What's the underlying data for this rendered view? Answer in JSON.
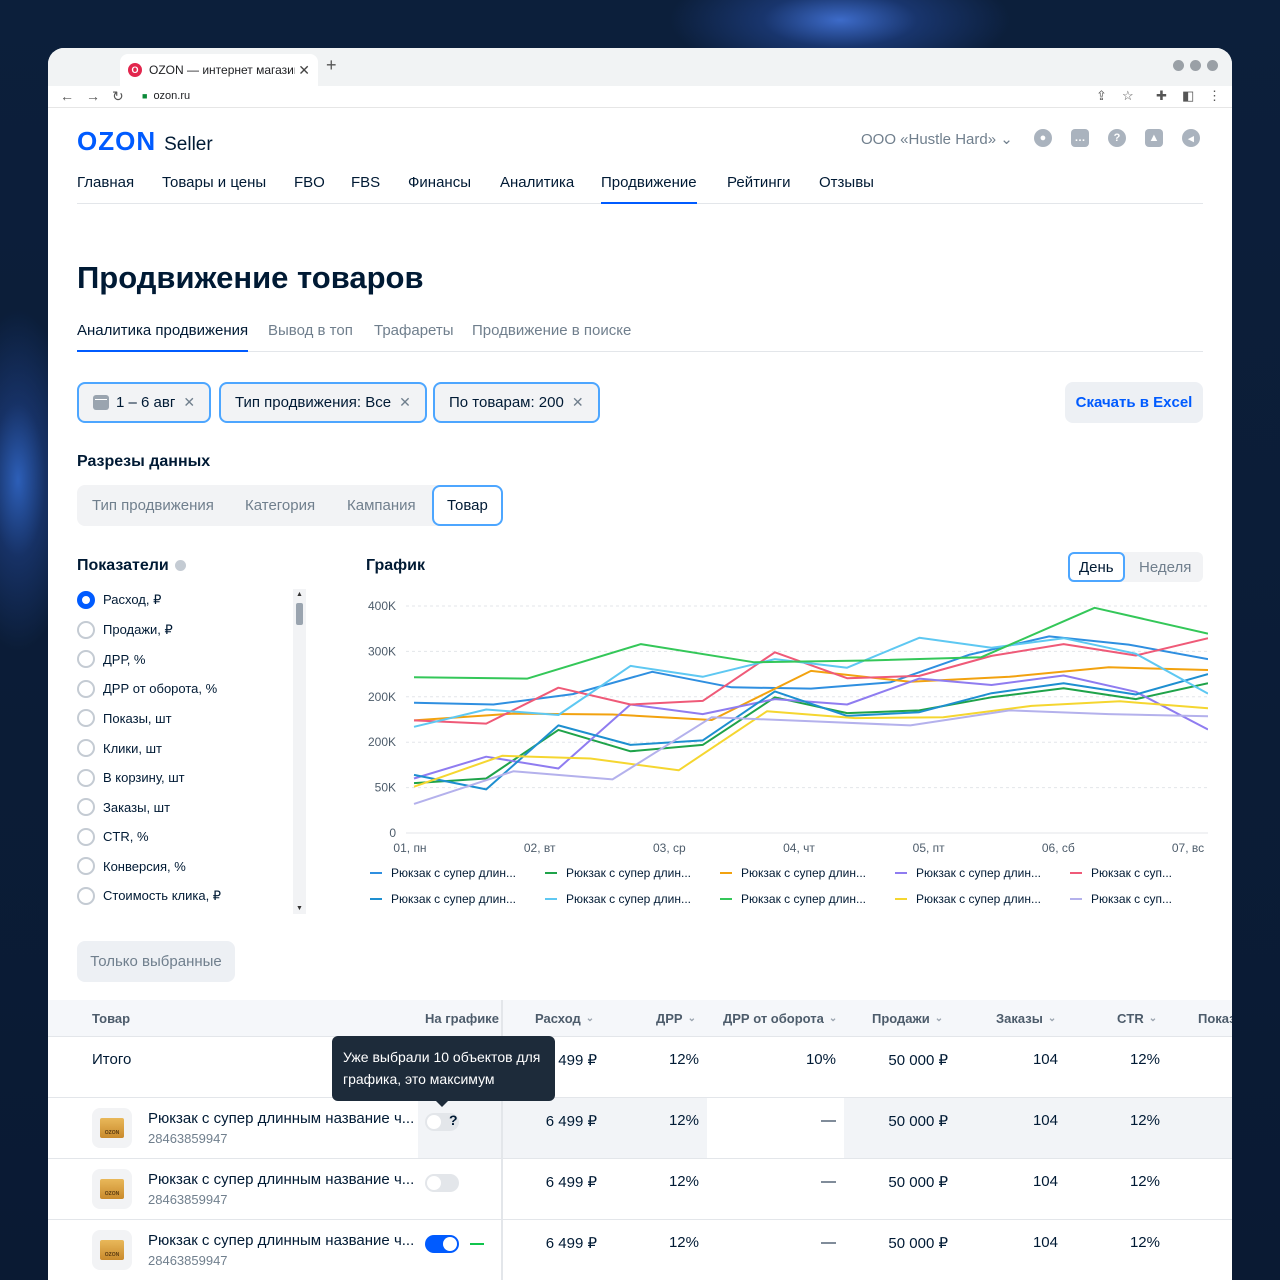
{
  "browser": {
    "tab_title": "OZON — интернет магазин",
    "tab_favicon": "ozon-favicon",
    "new_tab": "+",
    "close": "✕",
    "url": "ozon.ru"
  },
  "header": {
    "logo": "OZON",
    "logo_sub": "Seller",
    "org": "ООО «Hustle Hard» ⌄",
    "icons": [
      "user-icon",
      "chat-icon",
      "help-icon",
      "education-icon",
      "megaphone-icon"
    ]
  },
  "main_nav": [
    {
      "label": "Главная",
      "active": false
    },
    {
      "label": "Товары и цены",
      "active": false
    },
    {
      "label": "FBO",
      "active": false
    },
    {
      "label": "FBS",
      "active": false
    },
    {
      "label": "Финансы",
      "active": false
    },
    {
      "label": "Аналитика",
      "active": false
    },
    {
      "label": "Продвижение",
      "active": true
    },
    {
      "label": "Рейтинги",
      "active": false
    },
    {
      "label": "Отзывы",
      "active": false
    }
  ],
  "page_title": "Продвижение товаров",
  "sub_nav": [
    {
      "label": "Аналитика продвижения",
      "active": true
    },
    {
      "label": "Вывод в топ",
      "active": false
    },
    {
      "label": "Трафареты",
      "active": false
    },
    {
      "label": "Продвижение в поиске",
      "active": false
    }
  ],
  "filters": [
    {
      "label": "1 – 6 авг"
    },
    {
      "label": "Тип продвижения: Все"
    },
    {
      "label": "По товарам: 200"
    }
  ],
  "excel_button": "Скачать в Excel",
  "slices": {
    "title": "Разрезы данных",
    "items": [
      {
        "label": "Тип продвижения",
        "active": false
      },
      {
        "label": "Категория",
        "active": false
      },
      {
        "label": "Кампания",
        "active": false
      },
      {
        "label": "Товар",
        "active": true
      }
    ]
  },
  "metrics": {
    "title": "Показатели",
    "items": [
      {
        "label": "Расход, ₽",
        "selected": true
      },
      {
        "label": "Продажи, ₽",
        "selected": false
      },
      {
        "label": "ДРР, %",
        "selected": false
      },
      {
        "label": "ДРР от оборота, %",
        "selected": false
      },
      {
        "label": "Показы, шт",
        "selected": false
      },
      {
        "label": "Клики, шт",
        "selected": false
      },
      {
        "label": "В корзину, шт",
        "selected": false
      },
      {
        "label": "Заказы, шт",
        "selected": false
      },
      {
        "label": "CTR, %",
        "selected": false
      },
      {
        "label": "Конверсия, %",
        "selected": false
      },
      {
        "label": "Стоимость клика, ₽",
        "selected": false
      }
    ]
  },
  "chart_title": "График",
  "period": [
    {
      "label": "День",
      "active": true
    },
    {
      "label": "Неделя",
      "active": false
    }
  ],
  "chart_data": {
    "type": "line",
    "x": [
      "01, пн",
      "02, вт",
      "03, ср",
      "04, чт",
      "05, пт",
      "06, сб",
      "07, вс"
    ],
    "y_ticks": [
      0,
      50000,
      100000,
      200000,
      300000,
      400000
    ],
    "y_tick_labels": [
      "0",
      "50K",
      "200K",
      "200K",
      "300K",
      "400K"
    ],
    "ylim": [
      0,
      400000
    ],
    "grid": true,
    "legend_position": "bottom",
    "series": [
      {
        "name": "Рюкзак с супер длинным названием",
        "color": "#2f8fe0",
        "values": [
          187000,
          183000,
          206000,
          255000,
          221000,
          218000,
          232000,
          293000,
          333000,
          315000,
          283000
        ]
      },
      {
        "name": "Рюкзак с супер длинным названием",
        "color": "#1fa34a",
        "values": [
          55000,
          60000,
          127000,
          90000,
          97000,
          199000,
          164000,
          170000,
          199000,
          219000,
          195000,
          230000
        ]
      },
      {
        "name": "Рюкзак с супер длинным названием",
        "color": "#f2a20f",
        "values": [
          148000,
          163000,
          161000,
          149000,
          257000,
          233000,
          244000,
          265000,
          259000
        ]
      },
      {
        "name": "Рюкзак с супер длинным названием",
        "color": "#8f7cf0",
        "values": [
          60000,
          84000,
          71000,
          183000,
          162000,
          195000,
          183000,
          240000,
          226000,
          247000,
          211000,
          128000
        ]
      },
      {
        "name": "Рюкзак с супер длинным названием",
        "color": "#ef5a78",
        "values": [
          148000,
          141000,
          220000,
          183000,
          191000,
          298000,
          241000,
          246000,
          290000,
          316000,
          291000,
          329000
        ]
      },
      {
        "name": "Рюкзак с супер длинным названием",
        "color": "#1e8fd0",
        "values": [
          64000,
          48000,
          137000,
          97000,
          104000,
          212000,
          158000,
          166000,
          208000,
          230000,
          205000,
          250000
        ]
      },
      {
        "name": "Рюкзак с супер длинным названием",
        "color": "#5ec8f2",
        "values": [
          134000,
          172000,
          160000,
          268000,
          244000,
          283000,
          264000,
          330000,
          308000,
          329000,
          295000,
          207000
        ]
      },
      {
        "name": "Рюкзак с супер длинным названием",
        "color": "#34c759",
        "values": [
          243000,
          240000,
          316000,
          276000,
          280000,
          287000,
          396000,
          339000
        ]
      },
      {
        "name": "Рюкзак с супер длинным названием",
        "color": "#f5d630",
        "values": [
          51000,
          85000,
          82000,
          69000,
          168000,
          153000,
          155000,
          180000,
          190000,
          175000
        ]
      },
      {
        "name": "Рюкзак с супер длинным названием",
        "color": "#b4b1ec",
        "values": [
          32000,
          68000,
          59000,
          155000,
          146000,
          137000,
          170000,
          162000,
          157000
        ]
      }
    ]
  },
  "legend": [
    {
      "label": "Рюкзак с супер длин...",
      "color": "#2f8fe0"
    },
    {
      "label": "Рюкзак с супер длин...",
      "color": "#1fa34a"
    },
    {
      "label": "Рюкзак с супер длин...",
      "color": "#f2a20f"
    },
    {
      "label": "Рюкзак с супер длин...",
      "color": "#8f7cf0"
    },
    {
      "label": "Рюкзак с суп...",
      "color": "#ef5a78"
    },
    {
      "label": "Рюкзак с супер длин...",
      "color": "#1e8fd0"
    },
    {
      "label": "Рюкзак с супер длин...",
      "color": "#5ec8f2"
    },
    {
      "label": "Рюкзак с супер длин...",
      "color": "#34c759"
    },
    {
      "label": "Рюкзак с супер длин...",
      "color": "#f5d630"
    },
    {
      "label": "Рюкзак с суп...",
      "color": "#b4b1ec"
    }
  ],
  "only_selected": "Только выбранные",
  "table": {
    "columns": [
      "Товар",
      "На графике",
      "Расход",
      "ДРР",
      "ДРР от оборота",
      "Продажи",
      "Заказы",
      "CTR",
      "Показ"
    ],
    "total": {
      "label": "Итого",
      "spend": "6 499 ₽",
      "drr": "12%",
      "drr_turnover": "10%",
      "sales": "50 000 ₽",
      "orders": "104",
      "ctr": "12%"
    },
    "rows": [
      {
        "name": "Рюкзак с супер длинным название ч...",
        "id": "28463859947",
        "on_chart": false,
        "spend": "6 499 ₽",
        "drr": "12%",
        "drr_turnover": "—",
        "sales": "50 000 ₽",
        "orders": "104",
        "ctr": "12%"
      },
      {
        "name": "Рюкзак с супер длинным название ч...",
        "id": "28463859947",
        "on_chart": false,
        "spend": "6 499 ₽",
        "drr": "12%",
        "drr_turnover": "—",
        "sales": "50 000 ₽",
        "orders": "104",
        "ctr": "12%"
      },
      {
        "name": "Рюкзак с супер длинным название ч...",
        "id": "28463859947",
        "on_chart": true,
        "spend": "6 499 ₽",
        "drr": "12%",
        "drr_turnover": "—",
        "sales": "50 000 ₽",
        "orders": "104",
        "ctr": "12%"
      }
    ],
    "tooltip": "Уже выбрали 10 объектов для графика, это максимум",
    "question_mark": "?",
    "box_label": "OZON"
  }
}
